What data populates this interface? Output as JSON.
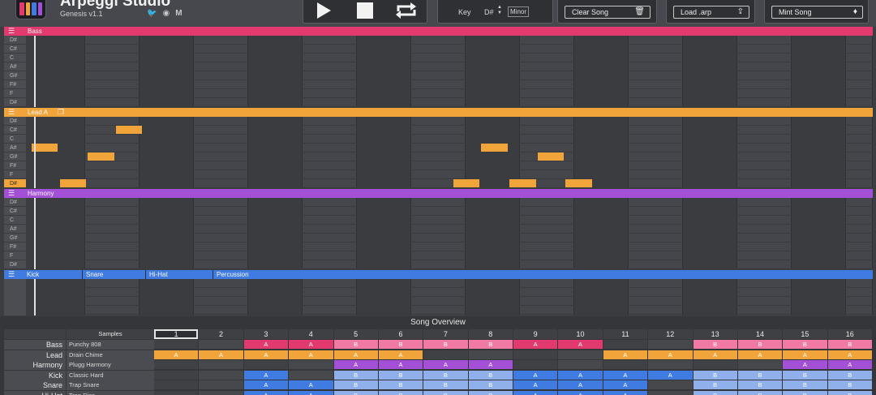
{
  "app": {
    "title": "Arpeggi Studio",
    "version": "Genesis v1.1",
    "logo_colors": [
      "#e23a6e",
      "#f0a43a",
      "#3f7be0",
      "#a34fd6"
    ],
    "socials": [
      {
        "name": "twitter-icon",
        "glyph": "🐦"
      },
      {
        "name": "discord-icon",
        "glyph": "◉"
      },
      {
        "name": "medium-icon",
        "glyph": "M"
      }
    ]
  },
  "transport": {
    "play": "play-icon",
    "stop": "stop-icon",
    "loop": "loop-icon"
  },
  "key_panel": {
    "label": "Key",
    "value": "D#",
    "mode": "Minor"
  },
  "buttons": {
    "clear_song": "Clear Song",
    "load_arp": "Load .arp",
    "mint_song": "Mint Song"
  },
  "colors": {
    "bass": "#e23a6e",
    "lead": "#f0a43a",
    "harmony": "#a34fd6",
    "drums": "#3f7be0"
  },
  "tracks": {
    "bass": {
      "name": "Bass",
      "notes": [
        "D#",
        "C#",
        "C",
        "A#",
        "G#",
        "F#",
        "F",
        "D#"
      ]
    },
    "lead": {
      "name": "Lead A",
      "notes": [
        "D#",
        "C#",
        "C",
        "A#",
        "G#",
        "F#",
        "F",
        "D#"
      ],
      "active_notes": [
        {
          "row": 3,
          "step": 0
        },
        {
          "row": 7,
          "step": 1
        },
        {
          "row": 4,
          "step": 2
        },
        {
          "row": 1,
          "step": 3
        },
        {
          "row": 7,
          "step": 15
        },
        {
          "row": 3,
          "step": 16
        },
        {
          "row": 7,
          "step": 17
        },
        {
          "row": 4,
          "step": 18
        },
        {
          "row": 7,
          "step": 19
        }
      ]
    },
    "harmony": {
      "name": "Harmony",
      "notes": [
        "D#",
        "C#",
        "C",
        "A#",
        "G#",
        "F#",
        "F",
        "D#"
      ]
    },
    "drums": {
      "tabs": [
        "Kick",
        "Snare",
        "Hi-Hat",
        "Percussion"
      ]
    }
  },
  "overview": {
    "title": "Song Overview",
    "samples_header": "Samples",
    "columns": [
      "1",
      "2",
      "3",
      "4",
      "5",
      "6",
      "7",
      "8",
      "9",
      "10",
      "11",
      "12",
      "13",
      "14",
      "15",
      "16"
    ],
    "selected_column": 0,
    "rows": [
      {
        "track": "Bass",
        "sample": "Punchy 808",
        "color": "#e23a6e",
        "light": "#f07aa3",
        "cells": [
          "",
          "",
          "A",
          "A",
          "B",
          "B",
          "B",
          "B",
          "A",
          "A",
          "",
          "",
          "B",
          "B",
          "B",
          "B"
        ]
      },
      {
        "track": "Lead",
        "sample": "Drain Chime",
        "color": "#f0a43a",
        "light": "#f0a43a",
        "cells": [
          "A",
          "A",
          "A",
          "A",
          "A",
          "A",
          "",
          "",
          "",
          "",
          "A",
          "A",
          "A",
          "A",
          "A",
          "A"
        ]
      },
      {
        "track": "Harmony",
        "sample": "Plugg Harmony",
        "color": "#a34fd6",
        "light": "#a34fd6",
        "cells": [
          "",
          "",
          "",
          "",
          "A",
          "A",
          "A",
          "A",
          "",
          "",
          "",
          "",
          "",
          "",
          "A",
          "A"
        ]
      },
      {
        "track": "Kick",
        "sample": "Classic Hard",
        "color": "#3f7be0",
        "light": "#8fb0ea",
        "cells": [
          "",
          "",
          "A",
          "",
          "B",
          "B",
          "B",
          "B",
          "A",
          "A",
          "A",
          "A",
          "B",
          "B",
          "B",
          "B"
        ]
      },
      {
        "track": "Snare",
        "sample": "Trap Snare",
        "color": "#3f7be0",
        "light": "#8fb0ea",
        "cells": [
          "",
          "",
          "A",
          "A",
          "B",
          "B",
          "B",
          "B",
          "A",
          "A",
          "A",
          "",
          "B",
          "B",
          "B",
          "B"
        ]
      },
      {
        "track": "Hi-Hat",
        "sample": "Trap Rice",
        "color": "#3f7be0",
        "light": "#8fb0ea",
        "cells": [
          "",
          "",
          "A",
          "A",
          "B",
          "B",
          "B",
          "B",
          "A",
          "A",
          "A",
          "",
          "B",
          "B",
          "B",
          "B"
        ]
      }
    ]
  }
}
